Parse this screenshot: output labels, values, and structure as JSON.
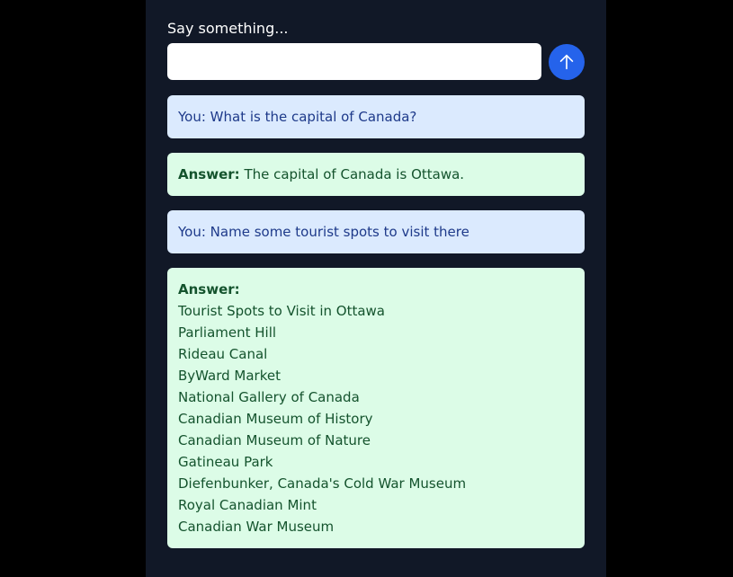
{
  "prompt": {
    "label": "Say something...",
    "input_value": "",
    "input_placeholder": ""
  },
  "send_button": {
    "icon": "arrow-up-icon",
    "color": "#2563eb"
  },
  "messages": [
    {
      "role": "user",
      "text": "You: What is the capital of Canada?"
    },
    {
      "role": "answer",
      "prefix": "Answer:",
      "text": "The capital of Canada is Ottawa."
    },
    {
      "role": "user",
      "text": "You: Name some tourist spots to visit there"
    },
    {
      "role": "answer",
      "prefix": "Answer:",
      "lines": [
        "Tourist Spots to Visit in Ottawa",
        "Parliament Hill",
        "Rideau Canal",
        "ByWard Market",
        "National Gallery of Canada",
        "Canadian Museum of History",
        "Canadian Museum of Nature",
        "Gatineau Park",
        "Diefenbunker, Canada's Cold War Museum",
        "Royal Canadian Mint",
        "Canadian War Museum"
      ]
    }
  ],
  "colors": {
    "page_background": "#000000",
    "panel_background": "#111827",
    "user_bubble": "#dbeafe",
    "user_text": "#1e3a8a",
    "answer_bubble": "#dcfce7",
    "answer_text": "#14532d"
  }
}
